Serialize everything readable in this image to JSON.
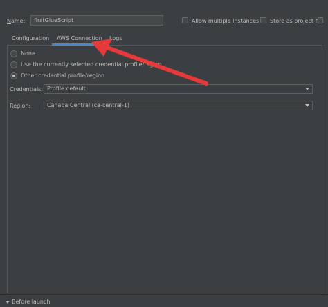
{
  "form": {
    "name_label_prefix": "N",
    "name_label_rest": "ame:",
    "name_value": "firstGlueScript",
    "allow_multiple_label": "Allow multiple instances",
    "store_as_project_label": "Store as project file"
  },
  "tabs": [
    {
      "label": "Configuration"
    },
    {
      "label": "AWS Connection"
    },
    {
      "label": "Logs"
    }
  ],
  "connection": {
    "options": [
      {
        "label": "None"
      },
      {
        "label": "Use the currently selected credential profile/region"
      },
      {
        "label": "Other credential profile/region"
      }
    ],
    "credentials_label": "Credentials:",
    "credentials_value": "Profile:default",
    "region_label": "Region:",
    "region_value": "Canada Central (ca-central-1)"
  },
  "footer": {
    "before_launch_label": "Before launch"
  },
  "colors": {
    "arrow": "#e5393a",
    "tab_underline": "#4a88c7"
  }
}
